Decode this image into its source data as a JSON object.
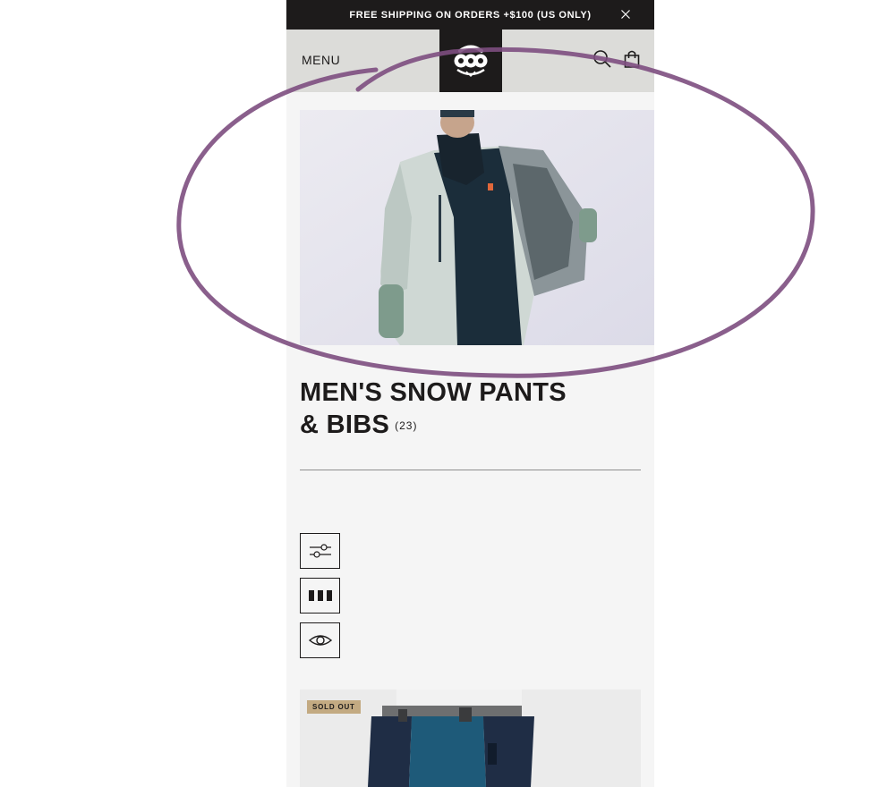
{
  "promo": {
    "text": "FREE SHIPPING ON ORDERS +$100 (US ONLY)"
  },
  "header": {
    "menu_label": "MENU"
  },
  "category": {
    "title_line1": "MEN'S SNOW PANTS",
    "title_line2": "& BIBS",
    "count": "(23)"
  },
  "products": [
    {
      "badge": "SOLD OUT"
    }
  ],
  "colors": {
    "promo_bg": "#1d1b1b",
    "header_bg": "#dcdcd9",
    "page_bg": "#f5f5f5",
    "badge_bg": "#c3aa82",
    "annotation": "#7d4e7f"
  },
  "icons": {
    "close": "close-icon",
    "logo": "brand-logo",
    "search": "search-icon",
    "cart": "shopping-bag-icon",
    "filter": "filter-sliders-icon",
    "grid": "grid-view-icon",
    "quick_view": "eye-icon"
  }
}
